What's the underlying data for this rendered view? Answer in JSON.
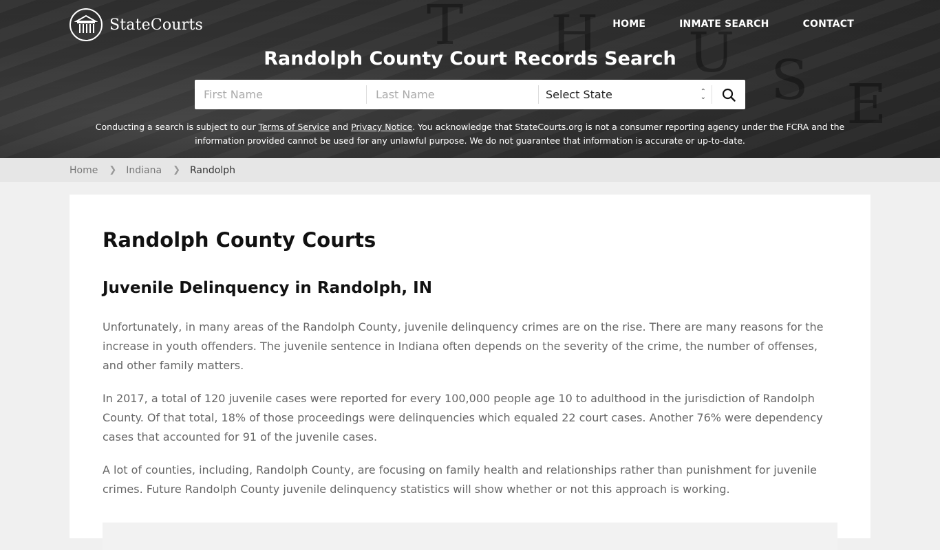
{
  "brand": {
    "name": "StateCourts",
    "logo_icon": "courthouse-columns-icon"
  },
  "nav": {
    "items": [
      "HOME",
      "INMATE SEARCH",
      "CONTACT"
    ]
  },
  "hero": {
    "title": "Randolph County Court Records Search",
    "search": {
      "first_name_placeholder": "First Name",
      "last_name_placeholder": "Last Name",
      "state_selected": "Select State",
      "search_icon": "magnifier-icon"
    },
    "disclaimer": {
      "prefix": "Conducting a search is subject to our ",
      "terms_link": "Terms of Service",
      "and": " and ",
      "privacy_link": "Privacy Notice",
      "suffix": ". You acknowledge that StateCourts.org is not a consumer reporting agency under the FCRA and the information provided cannot be used for any unlawful purpose. We do not guarantee that information is accurate or up-to-date."
    }
  },
  "breadcrumb": {
    "items": [
      "Home",
      "Indiana",
      "Randolph"
    ]
  },
  "main": {
    "title": "Randolph County Courts",
    "section_title": "Juvenile Delinquency in Randolph, IN",
    "paragraphs": [
      "Unfortunately, in many areas of the Randolph County, juvenile delinquency crimes are on the rise. There are many reasons for the increase in youth offenders. The juvenile sentence in Indiana often depends on the severity of the crime, the number of offenses, and other family matters.",
      "In 2017, a total of 120 juvenile cases were reported for every 100,000 people age 10 to adulthood in the jurisdiction of Randolph County. Of that total, 18% of those proceedings were delinquencies which equaled 22 court cases. Another 76% were dependency cases that accounted for 91 of the juvenile cases.",
      "A lot of counties, including, Randolph County, are focusing on family health and relationships rather than punishment for juvenile crimes. Future Randolph County juvenile delinquency statistics will show whether or not this approach is working."
    ]
  }
}
